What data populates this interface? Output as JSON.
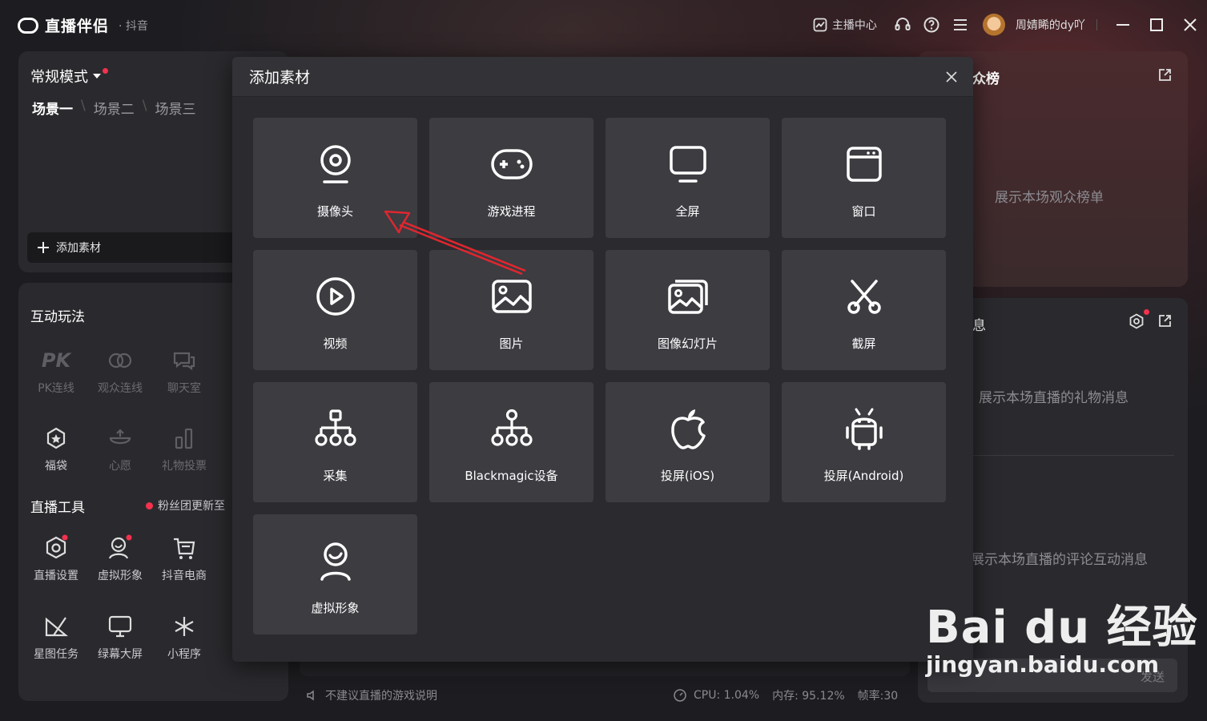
{
  "app": {
    "name": "直播伴侣",
    "platform": "抖音"
  },
  "topbar": {
    "anchor_center": "主播中心",
    "username": "周婧睎的dy吖"
  },
  "left": {
    "mode": "常规模式",
    "scenes": [
      "场景一",
      "场景二",
      "场景三"
    ],
    "add_source": "添加素材",
    "interactive_title": "互动玩法",
    "interactive_items": [
      "PK连线",
      "观众连线",
      "聊天室",
      "福袋",
      "心愿",
      "礼物投票"
    ],
    "tools_title": "直播工具",
    "tools_notice": "粉丝团更新至",
    "tool_items": [
      "直播设置",
      "虚拟形象",
      "抖音电商",
      "星图任务",
      "绿幕大屏",
      "小程序"
    ]
  },
  "center": {
    "game_note": "不建议直播的游戏说明"
  },
  "status": {
    "cpu": "CPU: 1.04%",
    "memory": "内存: 95.12%",
    "fps": "帧率:30"
  },
  "right": {
    "audience_title": "众榜",
    "audience_text": "展示本场观众榜单",
    "gift_title": "息",
    "gift_text": "展示本场直播的礼物消息",
    "comment_text": "展示本场直播的评论互动消息",
    "send": "发送"
  },
  "modal": {
    "title": "添加素材",
    "items": [
      "摄像头",
      "游戏进程",
      "全屏",
      "窗口",
      "视频",
      "图片",
      "图像幻灯片",
      "截屏",
      "采集",
      "Blackmagic设备",
      "投屏(iOS)",
      "投屏(Android)",
      "虚拟形象"
    ]
  },
  "watermark": {
    "brand": "Bai du 经验",
    "url": "jingyan.baidu.com"
  },
  "colors": {
    "accent_red": "#f5314e",
    "arrow_red": "#e0262f",
    "tile": "#3c3c41"
  }
}
